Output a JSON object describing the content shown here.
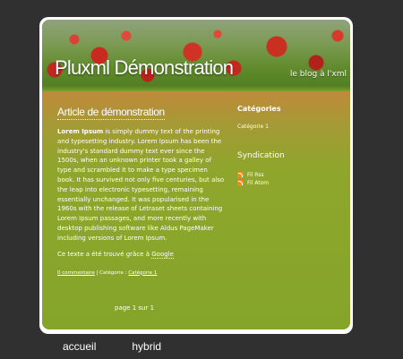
{
  "header": {
    "title": "Pluxml Démonstration",
    "description": "le blog à l'xml"
  },
  "article": {
    "title": "Article de démonstration",
    "lead": "Lorem Ipsum",
    "body": " is simply dummy text of the printing and typesetting industry. Lorem Ipsum has been the industry's standard dummy text ever since the 1500s, when an unknown printer took a galley of type and scrambled it to make a type specimen book. It has survived not only five centuries, but also the leap into electronic typesetting, remaining essentially unchanged. It was popularised in the 1960s with the release of Letraset sheets containing Lorem Ipsum passages, and more recently with desktop publishing software like Aldus PageMaker including versions of Lorem Ipsum.",
    "source_prefix": "Ce texte a été trouvé grâce à ",
    "source_link": "Google",
    "comments": "0 commentaire",
    "category_label": " | Catégorie : ",
    "category_link": "Catégorie 1"
  },
  "pagination": "page 1 sur 1",
  "sidebar": {
    "categories_title": "Catégories",
    "category_item": "Catégorie 1",
    "syndication_title": "Syndication",
    "feeds": [
      {
        "label": "Fil Rss",
        "icon": "rss-icon"
      },
      {
        "label": "Fil Atom",
        "icon": "rss-icon"
      }
    ]
  },
  "nav": {
    "home": "accueil",
    "hybrid": "hybrid"
  },
  "colors": {
    "background": "#303030",
    "content_green": "#86a62a",
    "poppy_red": "#c1281f"
  }
}
